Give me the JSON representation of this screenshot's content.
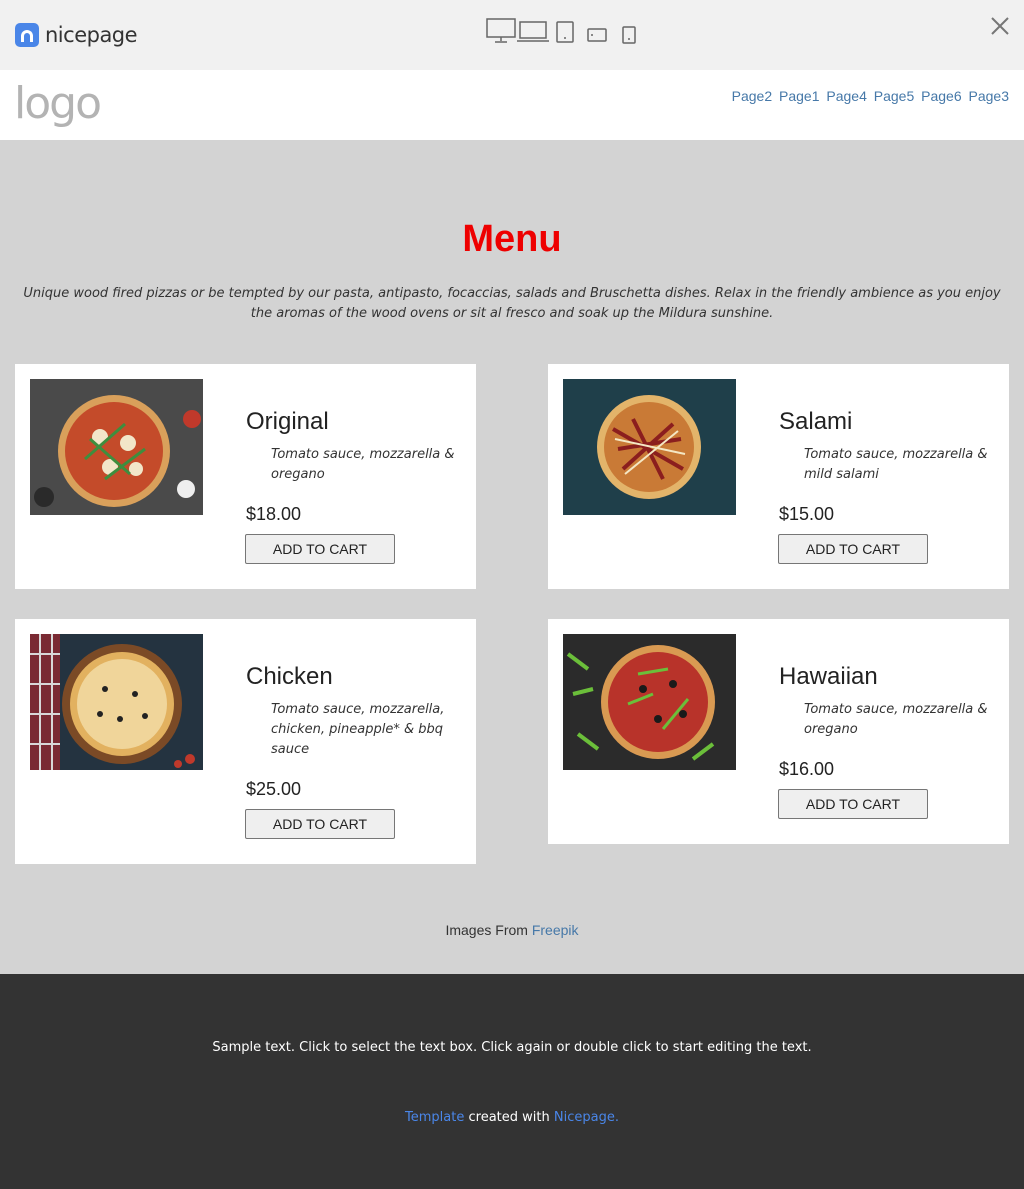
{
  "toolbar": {
    "brand": "nicepage",
    "devices": [
      "desktop-icon",
      "laptop-icon",
      "tablet-icon",
      "tablet-landscape-icon",
      "phone-icon"
    ],
    "close_icon": "close-icon"
  },
  "header": {
    "logo": "logo",
    "nav": [
      "Page2",
      "Page1",
      "Page4",
      "Page5",
      "Page6",
      "Page3"
    ]
  },
  "menu": {
    "title": "Menu",
    "intro": "Unique wood fired pizzas or be tempted by our pasta, antipasto, focaccias, salads and Bruschetta dishes. Relax in the friendly ambience as you enjoy the aromas of the wood ovens or sit al fresco and soak up the Mildura sunshine.",
    "items": [
      {
        "name": "Original",
        "desc": "Tomato sauce, mozzarella & oregano",
        "price": "$18.00",
        "button": "ADD TO CART"
      },
      {
        "name": "Salami",
        "desc": "Tomato sauce, mozzarella & mild salami",
        "price": "$15.00",
        "button": "ADD TO CART"
      },
      {
        "name": "Chicken",
        "desc": "Tomato sauce, mozzarella, chicken, pineapple* & bbq sauce",
        "price": "$25.00",
        "button": "ADD TO CART"
      },
      {
        "name": "Hawaiian",
        "desc": "Tomato sauce, mozzarella & oregano",
        "price": "$16.00",
        "button": "ADD TO CART"
      }
    ]
  },
  "credit": {
    "text": "Images From",
    "link": "Freepik"
  },
  "footer": {
    "sample": "Sample text. Click to select the text box. Click again or double click to start editing the text.",
    "template_link": "Template",
    "created_with": "created with",
    "nicepage_link": "Nicepage."
  },
  "colors": {
    "accent": "#e00000",
    "link": "#4678a8",
    "footer_bg": "#333333",
    "page_bg": "#d3d3d3"
  }
}
